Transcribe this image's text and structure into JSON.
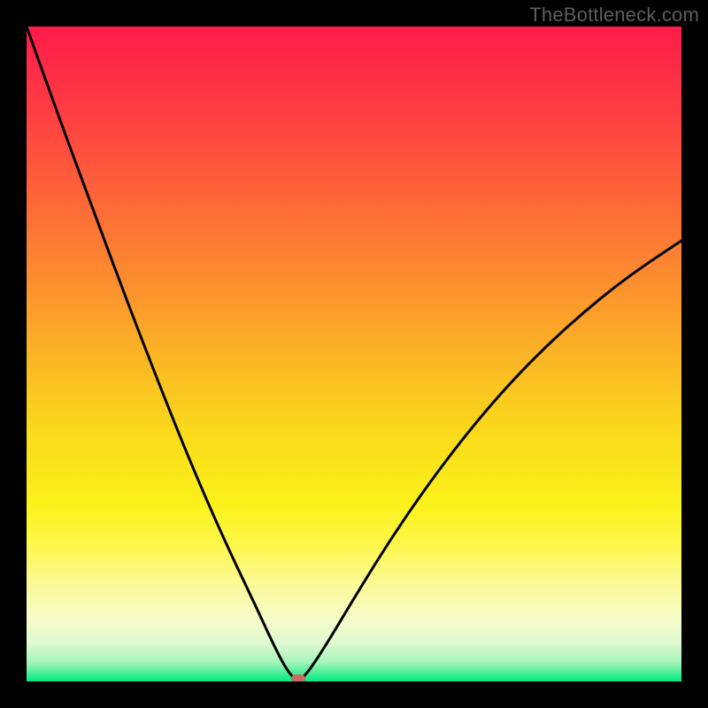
{
  "watermark": "TheBottleneck.com",
  "colors": {
    "bg_black": "#000000",
    "curve": "#000000",
    "marker": "#c96a63",
    "gradient_stops": [
      {
        "offset": 0.0,
        "color": "#fe1b48"
      },
      {
        "offset": 0.12,
        "color": "#fe3a44"
      },
      {
        "offset": 0.25,
        "color": "#fd6239"
      },
      {
        "offset": 0.38,
        "color": "#fc8b2f"
      },
      {
        "offset": 0.5,
        "color": "#fbb425"
      },
      {
        "offset": 0.62,
        "color": "#fada1b"
      },
      {
        "offset": 0.73,
        "color": "#fbf21a"
      },
      {
        "offset": 0.79,
        "color": "#fdf749"
      },
      {
        "offset": 0.85,
        "color": "#fcfa95"
      },
      {
        "offset": 0.9,
        "color": "#f7fcc5"
      },
      {
        "offset": 0.94,
        "color": "#e1fad2"
      },
      {
        "offset": 0.97,
        "color": "#a7f5bb"
      },
      {
        "offset": 1.0,
        "color": "#01ea7d"
      }
    ]
  },
  "chart_data": {
    "type": "line",
    "title": "",
    "xlabel": "",
    "ylabel": "",
    "xlim": [
      0,
      100
    ],
    "ylim": [
      0,
      100
    ],
    "annotations": [],
    "series": [
      {
        "name": "bottleneck-curve",
        "x": [
          0,
          5,
          10,
          15,
          20,
          25,
          30,
          35,
          38,
          40,
          41.5,
          43,
          46,
          50,
          55,
          60,
          65,
          70,
          75,
          80,
          85,
          90,
          95,
          100
        ],
        "values": [
          100,
          86,
          72.5,
          59,
          46,
          33.5,
          22,
          11.5,
          5,
          1.3,
          0,
          1.4,
          6,
          12.7,
          20.8,
          28.2,
          35,
          41.2,
          46.8,
          51.8,
          56.3,
          60.4,
          64,
          67.3
        ]
      }
    ],
    "marker": {
      "x": 41.5,
      "y": 0.4,
      "shape": "rounded-rect",
      "color": "#c96a63"
    }
  }
}
